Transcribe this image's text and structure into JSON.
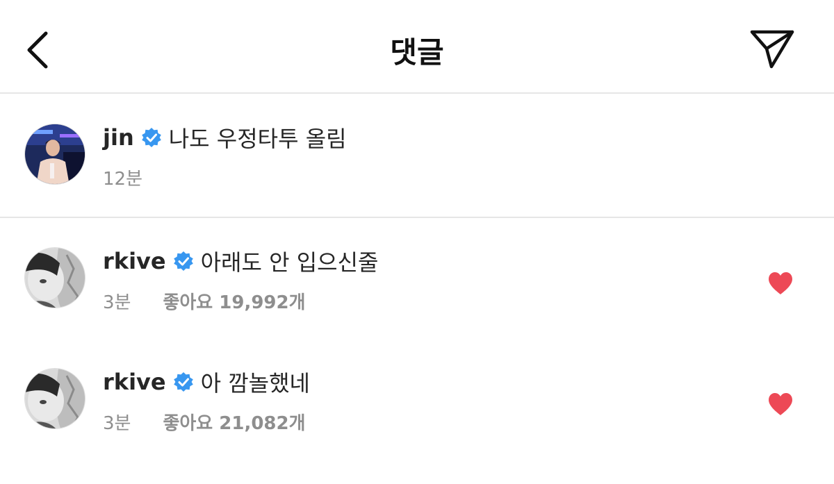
{
  "header": {
    "title": "댓글",
    "back_icon": "chevron-left-icon",
    "send_icon": "paper-plane-icon"
  },
  "comments": [
    {
      "username": "jin",
      "verified": true,
      "text": "나도 우정타투 올림",
      "time": "12분",
      "likes": "",
      "liked": false
    },
    {
      "username": "rkive",
      "verified": true,
      "text": "아래도 안 입으신줄",
      "time": "3분",
      "likes": "좋아요 19,992개",
      "liked": true
    },
    {
      "username": "rkive",
      "verified": true,
      "text": "아 깜놀했네",
      "time": "3분",
      "likes": "좋아요 21,082개",
      "liked": true
    }
  ],
  "colors": {
    "verified_blue": "#3897f0",
    "heart_red": "#ed4956",
    "meta_gray": "#8e8e8e",
    "divider": "#e6e6e6"
  }
}
